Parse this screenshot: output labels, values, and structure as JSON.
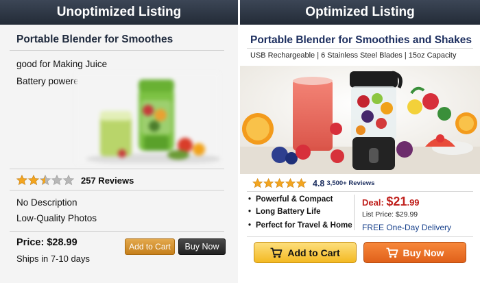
{
  "left": {
    "header": "Unoptimized Listing",
    "title": "Portable Blender for Smoothes",
    "desc": [
      "good for Making Juice",
      "Battery powered"
    ],
    "rating_stars": 2.5,
    "reviews": "257 Reviews",
    "notes": [
      "No Description",
      "Low-Quality Photos"
    ],
    "price": "Price: $28.99",
    "ships": "Ships in 7-10 days",
    "add_to_cart": "Add to Cart",
    "buy_now": "Buy Now"
  },
  "right": {
    "header": "Optimized Listing",
    "title": "Portable Blender for Smoothies and Shakes",
    "subtitle": "USB Rechargeable | 6 Stainless Steel Blades | 15oz Capacity",
    "rating_stars": 5,
    "rating": "4.8",
    "reviews": "3,500+ Reviews",
    "features": [
      "Powerful & Compact",
      "Long Battery Life",
      "Perfect for Travel & Home"
    ],
    "deal_label": "Deal:",
    "deal_dollars": "$21",
    "deal_cents": ".99",
    "list_price": "List Price: $29.99",
    "delivery": "FREE One-Day Delivery",
    "add_to_cart": "Add to Cart",
    "buy_now": "Buy Now"
  },
  "colors": {
    "header_bg": "#2b3442",
    "star_gold": "#f3a51f",
    "star_empty": "#b7b7b7",
    "deal_red": "#c0211d",
    "link_blue": "#143e8a",
    "cart_yellow": "#f5c13a",
    "buy_orange": "#e8661f"
  }
}
